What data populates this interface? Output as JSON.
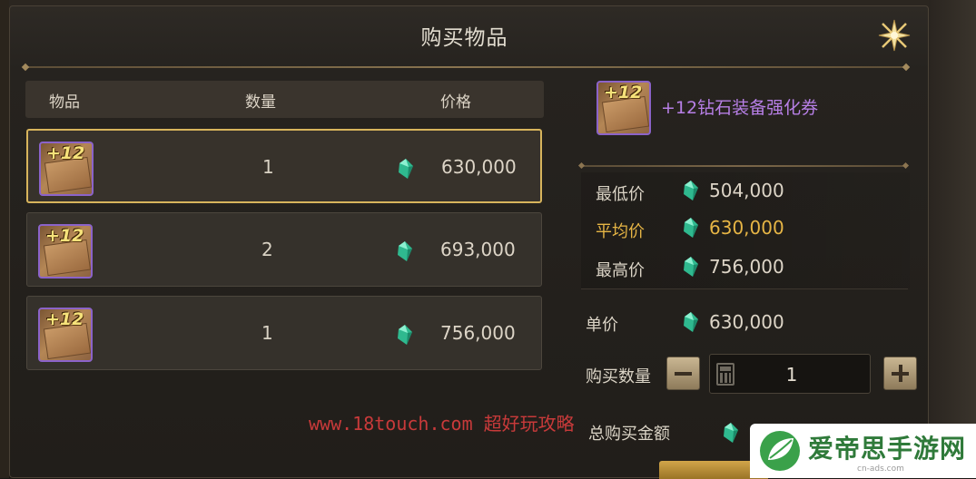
{
  "dialog": {
    "title": "购买物品",
    "close_icon": "close-star-icon"
  },
  "table": {
    "headers": {
      "item": "物品",
      "quantity": "数量",
      "price": "价格"
    },
    "rows": [
      {
        "icon_badge": "+12",
        "quantity": "1",
        "price": "630,000",
        "selected": true
      },
      {
        "icon_badge": "+12",
        "quantity": "2",
        "price": "693,000",
        "selected": false
      },
      {
        "icon_badge": "+12",
        "quantity": "1",
        "price": "756,000",
        "selected": false
      }
    ]
  },
  "detail": {
    "icon_badge": "+12",
    "item_name": "+12钻石装备强化券",
    "lowest_label": "最低价",
    "lowest_value": "504,000",
    "average_label": "平均价",
    "average_value": "630,000",
    "highest_label": "最高价",
    "highest_value": "756,000",
    "unit_price_label": "单价",
    "unit_price_value": "630,000",
    "buy_qty_label": "购买数量",
    "buy_qty_value": "1",
    "total_label": "总购买金额"
  },
  "watermark": "www.18touch.com 超好玩攻略",
  "logo": {
    "text": "爱帝思手游网",
    "sub": "cn-ads.com"
  },
  "colors": {
    "gem": "#3fd0a8",
    "selected_border": "#d7b45c",
    "item_name": "#b77fe6",
    "average": "#e6b545",
    "watermark": "#c83a3a"
  }
}
